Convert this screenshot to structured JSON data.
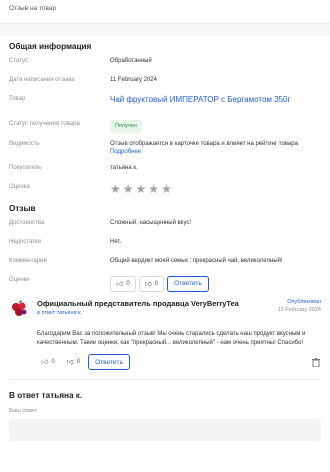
{
  "header": {
    "title": "Отзыв на товар"
  },
  "general": {
    "title": "Общая информация",
    "rows": {
      "status": {
        "label": "Статус",
        "value": "Обработанный"
      },
      "date": {
        "label": "Дата написания отзыва",
        "value": "11 February 2024"
      },
      "product": {
        "label": "Товар",
        "value": "Чай фруктовый ИМПЕРАТОР с Бергамотом  350г"
      },
      "receipt": {
        "label": "Статус получения товара",
        "value": "Получен"
      },
      "visibility": {
        "label": "Видимость",
        "value": "Отзыв отображается в карточке товара и влияет на рейтинг товара",
        "more": "Подробнее"
      },
      "buyer": {
        "label": "Покупатель",
        "value": "татьяна к."
      },
      "rating": {
        "label": "Оценка",
        "stars_total": 5,
        "stars_filled": 0
      }
    }
  },
  "review": {
    "title": "Отзыв",
    "rows": {
      "pros": {
        "label": "Достоинства",
        "value": "Сложный, насыщенный вкус!"
      },
      "cons": {
        "label": "Недостатки",
        "value": "Нет."
      },
      "comment": {
        "label": "Комментарий",
        "value": "Общий вердикт моей семьи : прекрасный чай, великолепный!"
      },
      "votes": {
        "label": "Оценки",
        "likes": "0",
        "dislikes": "0",
        "reply": "Ответить"
      }
    }
  },
  "seller_reply": {
    "name": "Официальный представитель продавца VeryBerryTea",
    "in_reply_to": "в ответ татьяна к.",
    "status": "Опубликован",
    "date": "13 February 2024",
    "text": "Благодарим Вас за положительный отзыв! Мы очень старались сделать наш продукт вкусным и качественным. Такие оценки, как \"прекрасный... великолепный\" - нам очень приятны! Спасибо!",
    "likes": "0",
    "dislikes": "0",
    "reply": "Ответить"
  },
  "answer": {
    "title": "В ответ татьяна к.",
    "label": "Ваш ответ",
    "value": ""
  },
  "colors": {
    "accent": "#1f5fd6",
    "badge_bg": "#e7f6ea",
    "badge_text": "#2e8b45"
  }
}
